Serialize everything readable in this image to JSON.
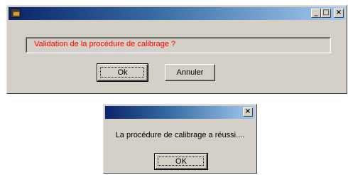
{
  "dialog1": {
    "title": "",
    "message": "Validation de la procédure de calibrage ?",
    "ok_label": "Ok",
    "cancel_label": "Annuler",
    "controls": {
      "minimize": "_",
      "maximize": "□",
      "close": "×"
    },
    "message_color": "#ff0000"
  },
  "dialog2": {
    "title": "",
    "message": "La procédure de calibrage a réussi....",
    "ok_label": "OK",
    "controls": {
      "close": "×"
    }
  },
  "colors": {
    "titlebar_start": "#0a246a",
    "titlebar_end": "#a6caf0",
    "window_bg": "#d4d0c8"
  }
}
